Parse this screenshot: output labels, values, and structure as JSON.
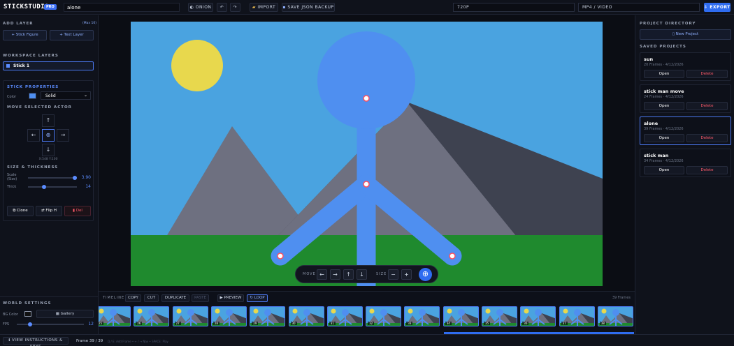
{
  "topbar": {
    "logo": "STICKSTUDIO",
    "badge": "PRO",
    "project_name": "alone",
    "onion": "ONION",
    "undo": "↶",
    "redo": "↷",
    "import": "IMPORT",
    "save_backup": "SAVE JSON BACKUP",
    "resolution": "720P",
    "format": "MP4 / VIDEO",
    "export": "EXPORT"
  },
  "left": {
    "add_layer_title": "ADD LAYER",
    "max_label": "(Max 10)",
    "stick_figure_btn": "+ Stick Figure",
    "text_layer_btn": "+ Text Layer",
    "workspace_title": "WORKSPACE LAYERS",
    "layer_name": "Stick 1",
    "stick_props_title": "STICK PROPERTIES",
    "color_label": "Color",
    "style_value": "Solid",
    "move_title": "MOVE SELECTED ACTOR",
    "coords": "X:548  Y:100",
    "size_title": "SIZE & THICKNESS",
    "scale_label": "Scale (Size)",
    "scale_value": "3.90",
    "scale_fraction": 0.96,
    "thick_label": "Thick",
    "thick_value": "14",
    "thick_fraction": 0.33,
    "clone_btn": "Clone",
    "flip_btn": "Flip H",
    "del_btn": "Del",
    "world_title": "WORLD SETTINGS",
    "bg_label": "BG Color",
    "gallery_btn": "Gallery",
    "fps_label": "FPS",
    "fps_value": "12",
    "fps_fraction": 0.2,
    "instructions_btn": "VIEW INSTRUCTIONS & KEYS"
  },
  "canvas": {
    "move_label": "MOVE",
    "size_label": "SIZE",
    "left_arrow": "←",
    "right_arrow": "→",
    "up_arrow": "↑",
    "down_arrow": "↓",
    "minus": "−",
    "plus": "+"
  },
  "timeline": {
    "title": "TIMELINE",
    "copy": "COPY",
    "cut": "CUT",
    "duplicate": "DUPLICATE",
    "paste": "PASTE",
    "preview": "PREVIEW",
    "loop": "LOOP",
    "frame_count": "39 Frames",
    "frame_numbers": [
      "25",
      "26",
      "27",
      "28",
      "29",
      "30",
      "31",
      "32",
      "33",
      "34",
      "35",
      "36",
      "37",
      "38",
      "39"
    ],
    "status": "Frame 39 / 39",
    "hint": "Q / E: Add Frame  •  ← / → Nav  •  SPACE: Play"
  },
  "right": {
    "directory_title": "PROJECT DIRECTORY",
    "new_project": "New Project",
    "saved_title": "SAVED PROJECTS",
    "projects": [
      {
        "name": "sun",
        "meta": "20 Frames · 4/12/2026",
        "open": "Open",
        "delete": "Delete"
      },
      {
        "name": "stick man move",
        "meta": "24 Frames · 4/12/2026",
        "open": "Open",
        "delete": "Delete"
      },
      {
        "name": "alone",
        "meta": "39 Frames · 4/12/2026",
        "open": "Open",
        "delete": "Delete"
      },
      {
        "name": "stick man",
        "meta": "34 Frames · 4/12/2026",
        "open": "Open",
        "delete": "Delete"
      }
    ]
  },
  "colors": {
    "accent": "#2f6cf0",
    "sky": "#4aa3e0",
    "sun": "#e8d84d",
    "mountain": "#6e7080",
    "grass": "#1f8a2e",
    "stick": "#4f8ff0",
    "joint": "#ff4f5f"
  }
}
